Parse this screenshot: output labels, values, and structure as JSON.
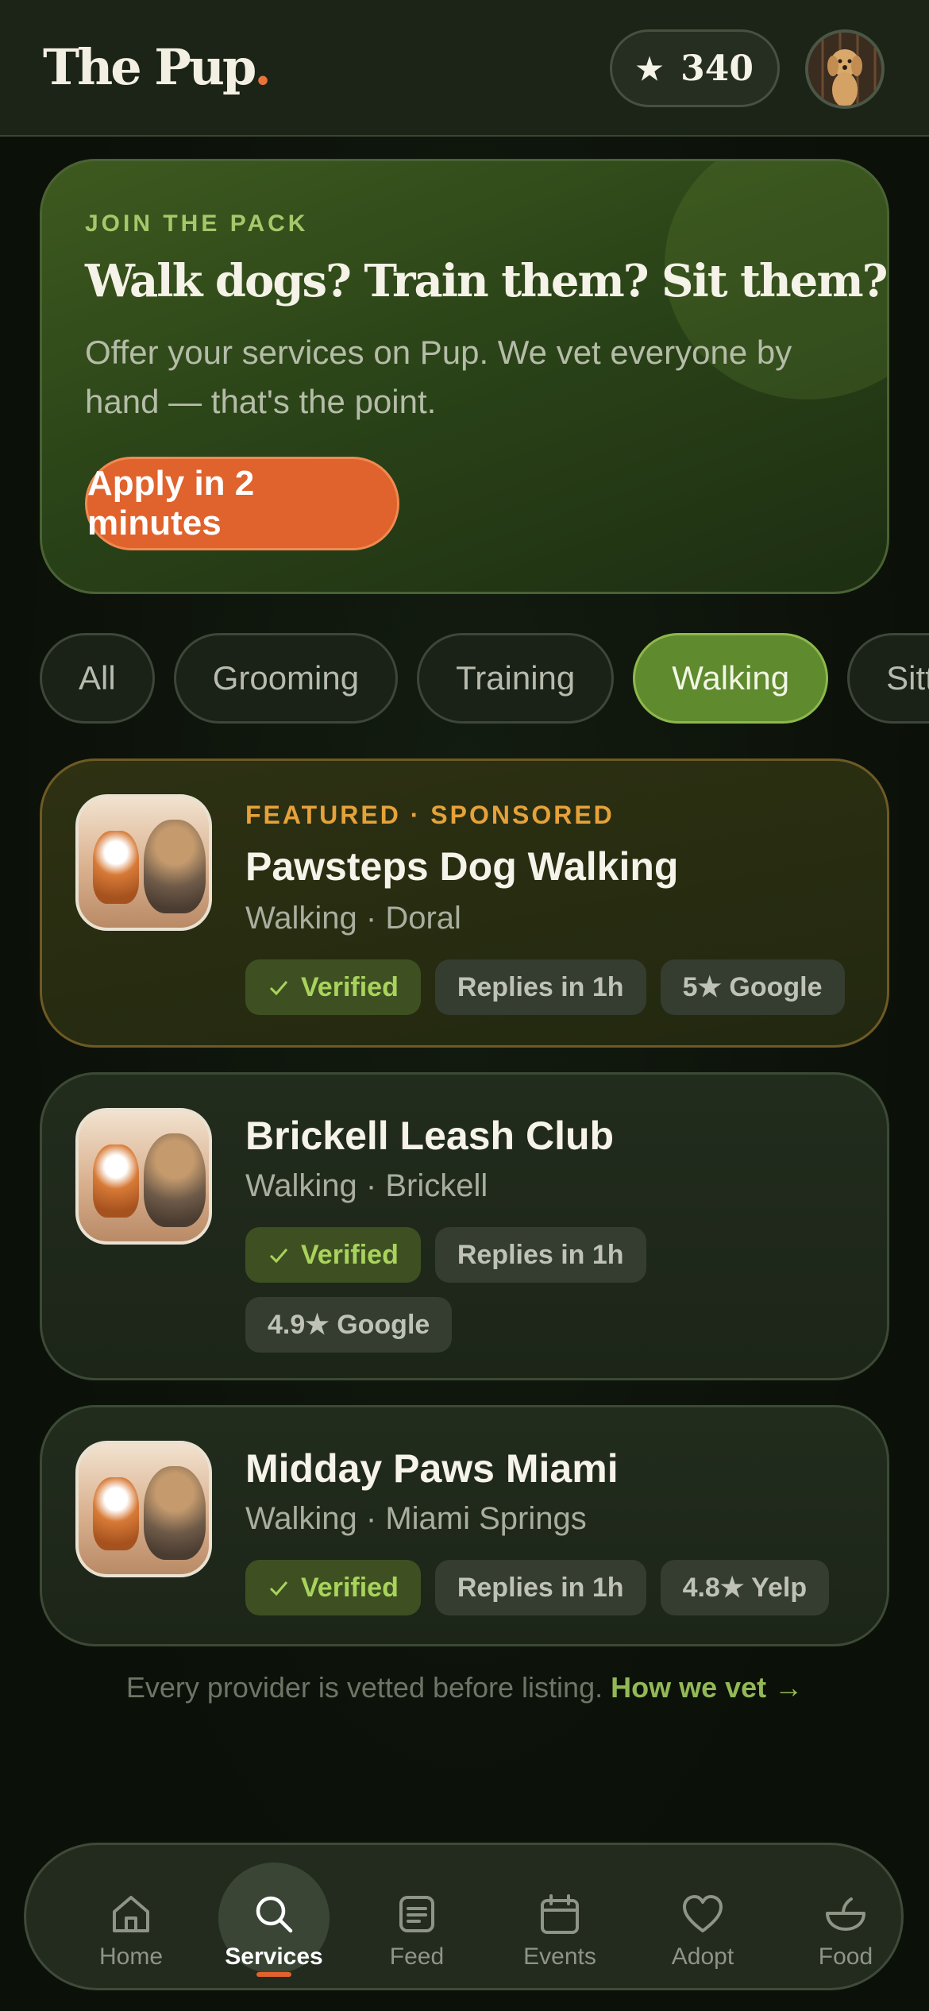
{
  "header": {
    "logo_text": "The Pup",
    "logo_dot": ".",
    "points": "340",
    "star": "★"
  },
  "promo": {
    "kicker": "JOIN THE PACK",
    "title": "Walk dogs? Train them? Sit them?",
    "description": "Offer your services on Pup. We vet everyone by hand — that's the point.",
    "cta_label": "Apply in 2 minutes"
  },
  "filters": [
    {
      "label": "All",
      "active": false
    },
    {
      "label": "Grooming",
      "active": false
    },
    {
      "label": "Training",
      "active": false
    },
    {
      "label": "Walking",
      "active": true
    },
    {
      "label": "Sitting",
      "active": false
    }
  ],
  "listings": [
    {
      "tag": "FEATURED · SPONSORED",
      "name": "Pawsteps Dog Walking",
      "subtitle": "Walking · Doral",
      "badges": [
        "Verified",
        "Replies in 1h",
        "5★ Google"
      ]
    },
    {
      "tag": "",
      "name": "Brickell Leash Club",
      "subtitle": "Walking · Brickell",
      "badges": [
        "Verified",
        "Replies in 1h",
        "4.9★ Google"
      ]
    },
    {
      "tag": "",
      "name": "Midday Paws Miami",
      "subtitle": "Walking · Miami Springs",
      "badges": [
        "Verified",
        "Replies in 1h",
        "4.8★ Yelp"
      ]
    }
  ],
  "footnote": {
    "text": "Every provider is vetted before listing.",
    "link": "How we vet →"
  },
  "nav": [
    {
      "label": "Home",
      "icon": "home-icon",
      "active": false
    },
    {
      "label": "Services",
      "icon": "search-icon",
      "active": true
    },
    {
      "label": "Feed",
      "icon": "feed-icon",
      "active": false
    },
    {
      "label": "Events",
      "icon": "calendar-icon",
      "active": false
    },
    {
      "label": "Adopt",
      "icon": "heart-icon",
      "active": false
    },
    {
      "label": "Food",
      "icon": "food-bowl-icon",
      "active": false
    }
  ],
  "colors": {
    "accent": "#e0622c",
    "brand_green": "#5f8a2d",
    "verified": "#a9d35c",
    "sponsored": "#e6a23a"
  }
}
